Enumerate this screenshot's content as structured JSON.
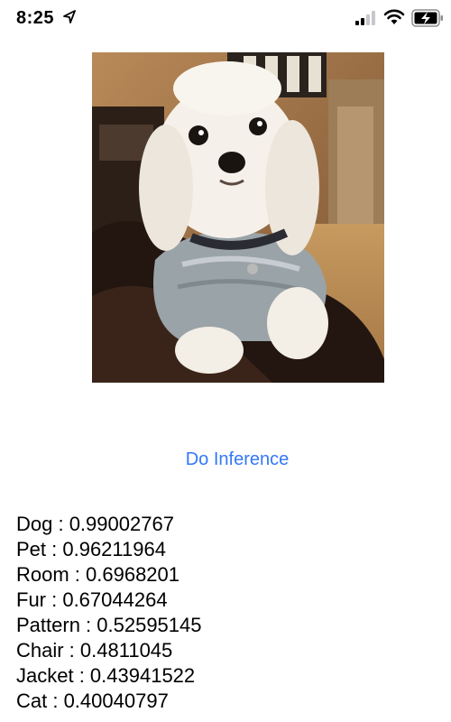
{
  "status_bar": {
    "time": "8:25",
    "icons": [
      "location-arrow-icon",
      "cellular-signal-icon",
      "wifi-icon",
      "battery-charging-icon"
    ]
  },
  "image": {
    "subject": "photo of a small white fluffy dog wearing a knit sweater, resting on a dark chair"
  },
  "inference_button": {
    "label": "Do Inference",
    "color": "#3478f6"
  },
  "results": [
    {
      "label": "Dog",
      "score": "0.99002767",
      "text": "Dog : 0.99002767"
    },
    {
      "label": "Pet",
      "score": "0.96211964",
      "text": "Pet : 0.96211964"
    },
    {
      "label": "Room",
      "score": "0.6968201",
      "text": "Room : 0.6968201"
    },
    {
      "label": "Fur",
      "score": "0.67044264",
      "text": "Fur : 0.67044264"
    },
    {
      "label": "Pattern",
      "score": "0.52595145",
      "text": "Pattern : 0.52595145"
    },
    {
      "label": "Chair",
      "score": "0.4811045",
      "text": "Chair : 0.4811045"
    },
    {
      "label": "Jacket",
      "score": "0.43941522",
      "text": "Jacket : 0.43941522"
    },
    {
      "label": "Cat",
      "score": "0.40040797",
      "text": "Cat : 0.40040797"
    }
  ]
}
